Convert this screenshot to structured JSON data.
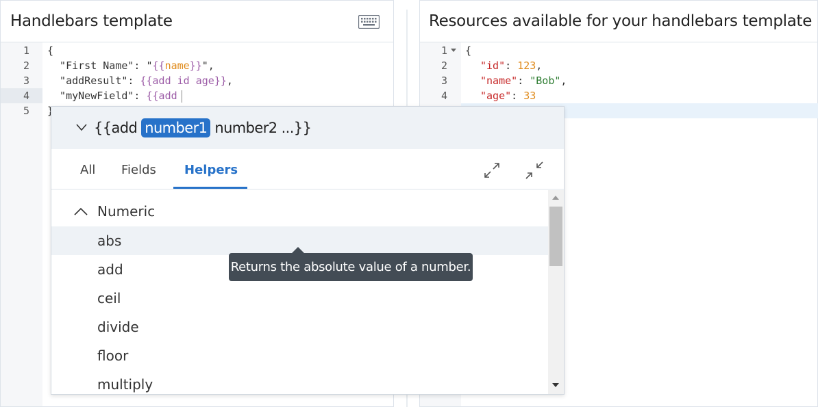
{
  "left_panel": {
    "title": "Handlebars template",
    "gutter": [
      "1",
      "2",
      "3",
      "4",
      "5"
    ],
    "lines": {
      "l1": "{",
      "l2_key": "  \"First Name\": \"",
      "l2_hb_open": "{{",
      "l2_var": "name",
      "l2_hb_close": "}}",
      "l2_end": "\",",
      "l3_key": "  \"addResult\": ",
      "l3_hb": "{{add id age}}",
      "l3_end": ",",
      "l4_key": "  \"myNewField\": ",
      "l4_hb": "{{add",
      "l5": "}"
    }
  },
  "right_panel": {
    "title": "Resources available for your handlebars template",
    "gutter": [
      "1",
      "2",
      "3",
      "4"
    ],
    "lines": {
      "l1": "{",
      "l2_key": "\"id\"",
      "l2_sep": ": ",
      "l2_val": "123",
      "l2_end": ",",
      "l3_key": "\"name\"",
      "l3_sep": ": ",
      "l3_val": "\"Bob\"",
      "l3_end": ",",
      "l4_key": "\"age\"",
      "l4_sep": ": ",
      "l4_val": "33"
    }
  },
  "autocomplete": {
    "signature": {
      "prefix": "{{add",
      "active_param": "number1",
      "rest": "number2 ...}}"
    },
    "tabs": [
      {
        "label": "All"
      },
      {
        "label": "Fields"
      },
      {
        "label": "Helpers"
      }
    ],
    "active_tab": "Helpers",
    "group": "Numeric",
    "items": [
      "abs",
      "add",
      "ceil",
      "divide",
      "floor",
      "multiply"
    ],
    "hovered_item": "abs",
    "tooltip": "Returns the absolute value of a number."
  },
  "colors": {
    "accent": "#2772c9",
    "tooltip_bg": "#434c55",
    "handlebars": "#9b5aa6",
    "json_key": "#c62828",
    "json_number": "#e08a1a",
    "json_string": "#2e7d32"
  },
  "icons": {
    "keyboard": "keyboard-icon",
    "expand": "expand-icon",
    "collapse": "collapse-icon",
    "chevron": "chevron-down-icon",
    "fold": "fold-arrow-icon"
  }
}
